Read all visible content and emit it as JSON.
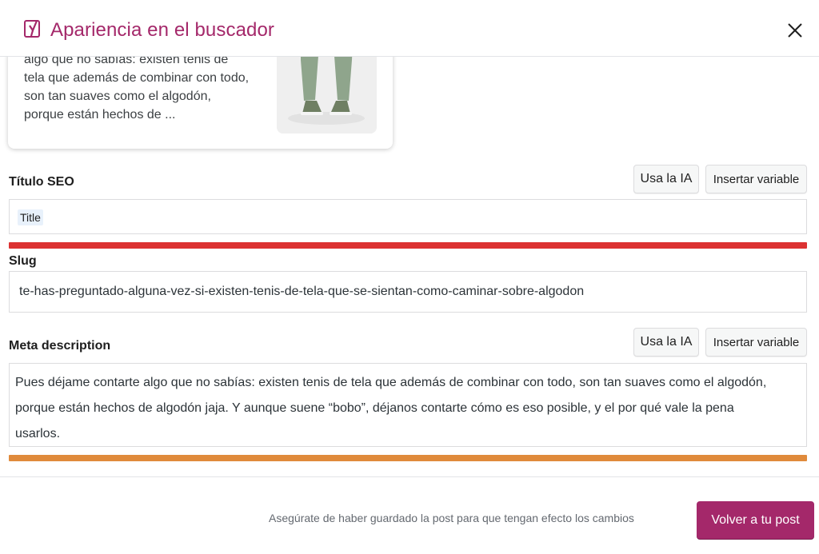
{
  "modal": {
    "title": "Apariencia en el buscador",
    "logo_icon": "yoast-logo-icon",
    "close_icon": "close-icon"
  },
  "preview": {
    "lines": [
      "algo que no sabías: existen tenis de",
      "tela que además de combinar con todo,",
      "son tan suaves como el algodón,",
      "porque están hechos de ..."
    ]
  },
  "seo_title": {
    "label": "Título SEO",
    "ai_button": "Usa la IA",
    "insert_variable_button": "Insertar variable",
    "variable_chip": "Title",
    "progress_color": "#dc3232"
  },
  "slug": {
    "label": "Slug",
    "value": "te-has-preguntado-alguna-vez-si-existen-tenis-de-tela-que-se-sientan-como-caminar-sobre-algodon"
  },
  "meta_description": {
    "label": "Meta description",
    "ai_button": "Usa la IA",
    "insert_variable_button": "Insertar variable",
    "lines": [
      "Pues déjame contarte algo que no sabías: existen tenis de tela que además de combinar con todo, son tan suaves como el algodón,",
      "porque están hechos de algodón jaja. Y aunque suene “bobo”, déjanos contarte cómo es eso posible, y el por qué vale la pena",
      "usarlos."
    ],
    "progress_color": "#e08a3b"
  },
  "footer": {
    "note": "Asegúrate de haber guardado la post para que tengan efecto los cambios",
    "primary_button": "Volver a tu post"
  },
  "colors": {
    "brand": "#a4286a",
    "title_progress": "#dc3232",
    "meta_progress": "#e08a3b"
  }
}
